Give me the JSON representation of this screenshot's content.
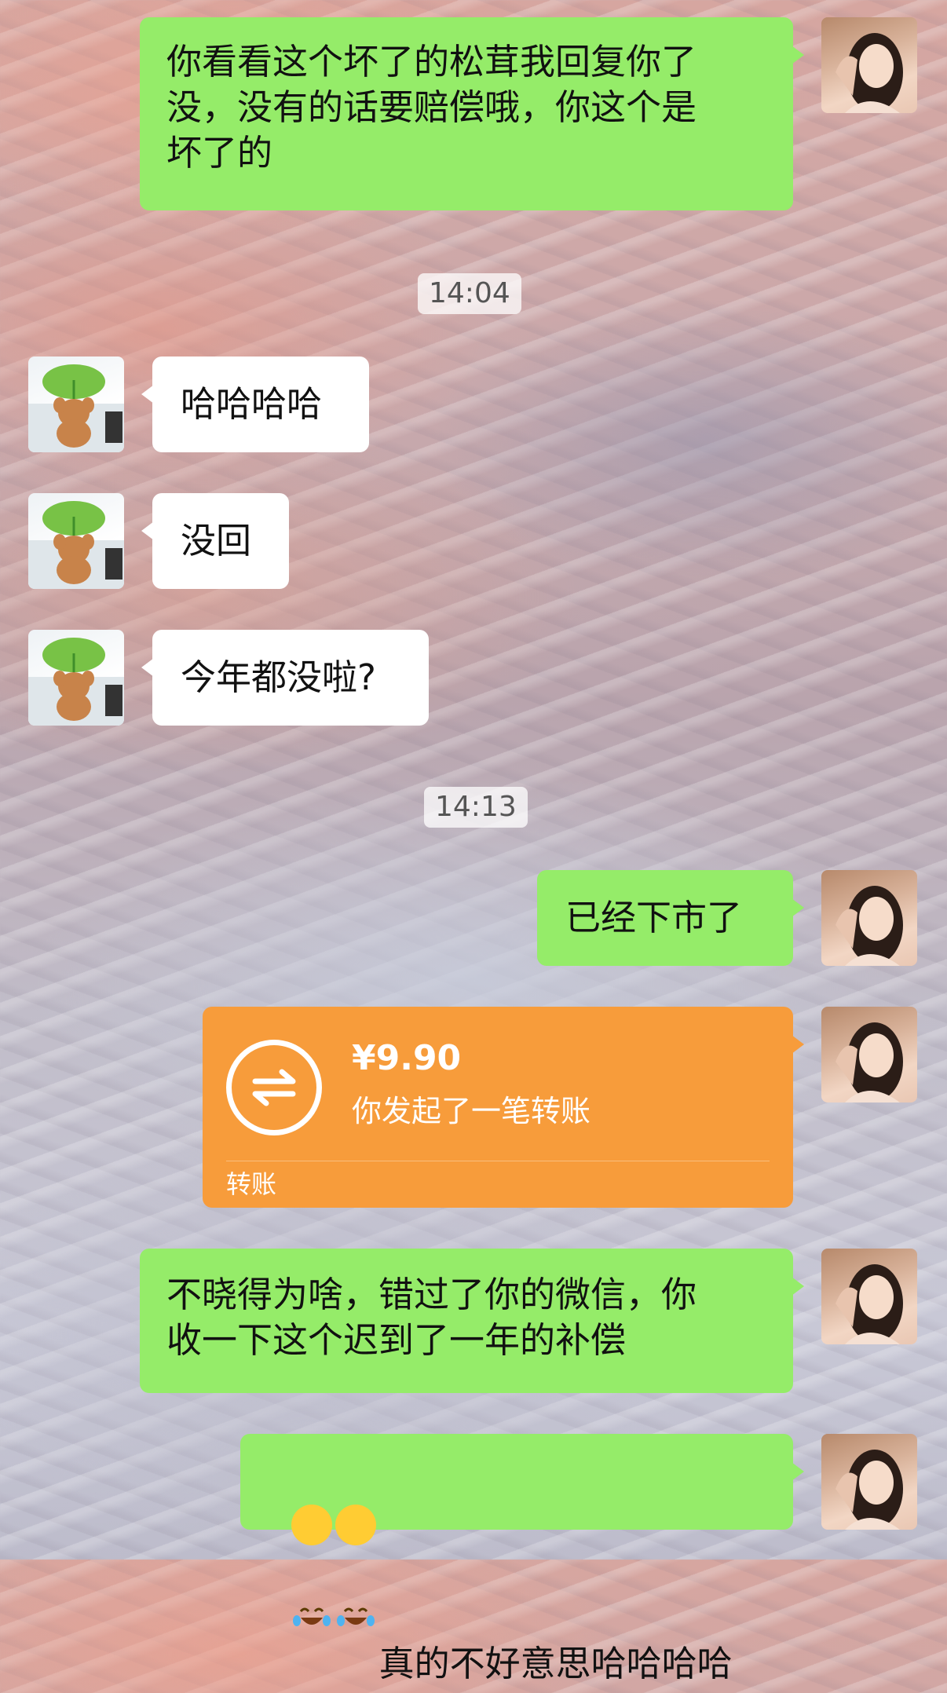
{
  "chat": {
    "messages": [
      {
        "side": "self",
        "text": "你看看这个坏了的松茸我回复你了\n没，没有的话要赔偿哦，你这个是\n坏了的"
      },
      {
        "side": "time",
        "text": "14:04"
      },
      {
        "side": "other",
        "text": "哈哈哈哈"
      },
      {
        "side": "other",
        "text": "没回"
      },
      {
        "side": "other",
        "text": "今年都没啦?"
      },
      {
        "side": "time",
        "text": "14:13"
      },
      {
        "side": "self",
        "text": "已经下市了"
      },
      {
        "side": "self",
        "type": "transfer",
        "amount": "¥9.90",
        "description": "你发起了一笔转账",
        "label": "转账"
      },
      {
        "side": "self",
        "text": "不晓得为啥，错过了你的微信，你\n收一下这个迟到了一年的补偿"
      },
      {
        "side": "self",
        "emoji": [
          "laughing-tears-emoji",
          "laughing-tears-emoji"
        ],
        "text": "真的不好意思哈哈哈哈"
      }
    ]
  },
  "colors": {
    "self_bubble": "#95ec69",
    "other_bubble": "#ffffff",
    "transfer": "#f79c3b"
  }
}
